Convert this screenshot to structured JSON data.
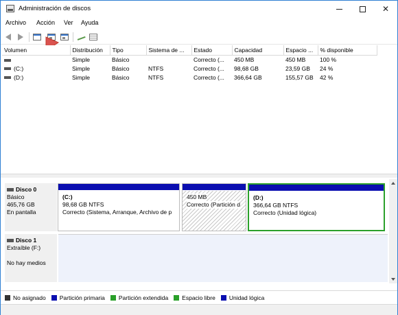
{
  "window": {
    "title": "Administración de discos",
    "controls": {
      "minimize_icon": "minimize-icon",
      "maximize_icon": "maximize-icon",
      "close_label": "✕"
    }
  },
  "menu": [
    "Archivo",
    "Acción",
    "Ver",
    "Ayuda"
  ],
  "toolbar": {
    "buttons": [
      "back-icon",
      "forward-icon",
      "console-window-icon",
      "disk-properties-icon",
      "refresh-icon",
      "key-help-icon",
      "list-view-icon"
    ]
  },
  "volume_table": {
    "columns": [
      "Volumen",
      "Distribución",
      "Tipo",
      "Sistema de ...",
      "Estado",
      "Capacidad",
      "Espacio ...",
      "% disponible"
    ],
    "rows": [
      {
        "volume": "",
        "layout": "Simple",
        "type": "Básico",
        "fs": "",
        "status": "Correcto (...",
        "capacity": "450 MB",
        "free": "450 MB",
        "pct": "100 %"
      },
      {
        "volume": "(C:)",
        "layout": "Simple",
        "type": "Básico",
        "fs": "NTFS",
        "status": "Correcto (...",
        "capacity": "98,68 GB",
        "free": "23,59 GB",
        "pct": "24 %"
      },
      {
        "volume": "(D:)",
        "layout": "Simple",
        "type": "Básico",
        "fs": "NTFS",
        "status": "Correcto (...",
        "capacity": "366,64 GB",
        "free": "155,57 GB",
        "pct": "42 %"
      }
    ]
  },
  "disks": [
    {
      "name": "Disco 0",
      "kind": "Básico",
      "size": "465,76 GB",
      "state": "En pantalla",
      "partitions": [
        {
          "name": "(C:)",
          "size": "98,68 GB NTFS",
          "status": "Correcto (Sistema, Arranque, Archivo de p"
        },
        {
          "name": "",
          "size": "450 MB",
          "status": "Correcto (Partición d"
        },
        {
          "name": "(D:)",
          "size": "366,64 GB NTFS",
          "status": "Correcto (Unidad lógica)"
        }
      ]
    },
    {
      "name": "Disco 1",
      "kind": "Extraíble (F:)",
      "size": "",
      "state": "No hay medios"
    }
  ],
  "legend": [
    {
      "label": "No asignado",
      "color": "#333333"
    },
    {
      "label": "Partición primaria",
      "color": "#0a0eb0"
    },
    {
      "label": "Partición extendida",
      "color": "#2aa02a"
    },
    {
      "label": "Espacio libre",
      "color": "#2aa02a"
    },
    {
      "label": "Unidad lógica",
      "color": "#0a0eb0"
    }
  ],
  "colors": {
    "accent_border": "#2d7fd3",
    "primary_bar": "#0a0eb0",
    "selected_border": "#2aa02a",
    "annotation_arrow": "#d9534f"
  }
}
